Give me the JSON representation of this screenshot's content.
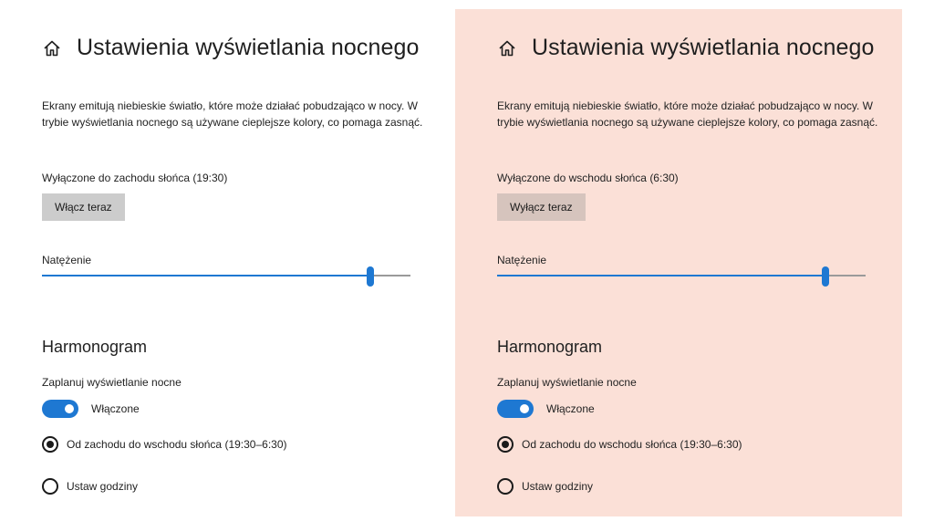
{
  "colors": {
    "accent": "#1e78d2",
    "night_tint": "#fbe0d7"
  },
  "panels": [
    {
      "title": "Ustawienia wyświetlania nocnego",
      "description": "Ekrany emitują niebieskie światło, które może działać pobudzająco w nocy. W trybie wyświetlania nocnego są używane cieplejsze kolory, co pomaga zasnąć.",
      "status": "Wyłączone do zachodu słońca (19:30)",
      "button_label": "Włącz teraz",
      "intensity_label": "Natężenie",
      "intensity_value": 0.89,
      "schedule_heading": "Harmonogram",
      "schedule_label": "Zaplanuj wyświetlanie nocne",
      "toggle_label": "Włączone",
      "toggle_on": true,
      "radio_sunset": "Od zachodu do wschodu słońca (19:30–6:30)",
      "radio_hours": "Ustaw godziny",
      "selected_option": "sunset"
    },
    {
      "title": "Ustawienia wyświetlania nocnego",
      "description": "Ekrany emitują niebieskie światło, które może działać pobudzająco w nocy. W trybie wyświetlania nocnego są używane cieplejsze kolory, co pomaga zasnąć.",
      "status": "Wyłączone do wschodu słońca (6:30)",
      "button_label": "Wyłącz teraz",
      "intensity_label": "Natężenie",
      "intensity_value": 0.89,
      "schedule_heading": "Harmonogram",
      "schedule_label": "Zaplanuj wyświetlanie nocne",
      "toggle_label": "Włączone",
      "toggle_on": true,
      "radio_sunset": "Od zachodu do wschodu słońca (19:30–6:30)",
      "radio_hours": "Ustaw godziny",
      "selected_option": "sunset"
    }
  ]
}
